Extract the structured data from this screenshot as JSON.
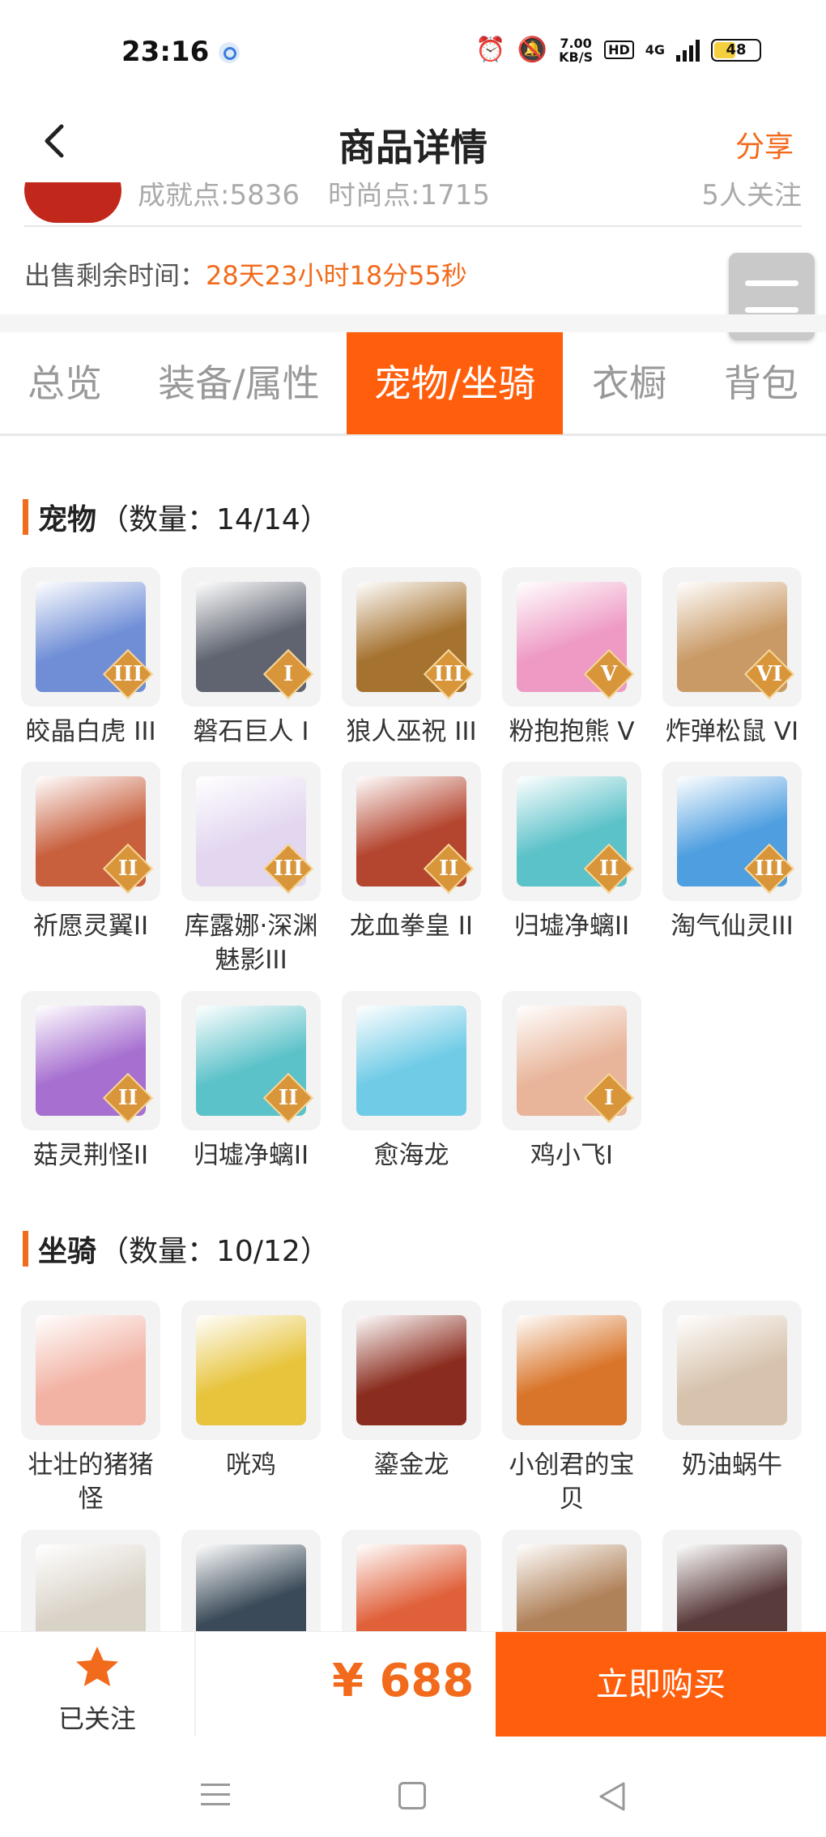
{
  "status_bar": {
    "time": "23:16",
    "speed_value": "7.00",
    "speed_unit": "KB/S",
    "hd": "HD",
    "network": "4G",
    "battery": "48",
    "battery_fraction": 0.48
  },
  "nav": {
    "title": "商品详情",
    "share_label": "分享"
  },
  "peek": {
    "text1": "成就点:5836",
    "text2": "时尚点:1715",
    "text3": "5人关注"
  },
  "timer": {
    "label": "出售剩余时间：",
    "value": "28天23小时18分55秒"
  },
  "tabs": [
    {
      "label": "总览"
    },
    {
      "label": "装备/属性"
    },
    {
      "label": "宠物/坐骑"
    },
    {
      "label": "衣橱"
    },
    {
      "label": "背包"
    }
  ],
  "active_tab": "宠物/坐骑",
  "pets": {
    "title": "宠物",
    "count": "（数量：14/14）",
    "items": [
      {
        "name": "皎晶白虎 III",
        "rank": "III",
        "color": "#6f8ed6"
      },
      {
        "name": "磐石巨人 I",
        "rank": "I",
        "color": "#5f6470"
      },
      {
        "name": "狼人巫祝 III",
        "rank": "III",
        "color": "#a5722f"
      },
      {
        "name": "粉抱抱熊 V",
        "rank": "V",
        "color": "#ee9ac4"
      },
      {
        "name": "炸弹松鼠 VI",
        "rank": "VI",
        "color": "#c99a66"
      },
      {
        "name": "祈愿灵翼II",
        "rank": "II",
        "color": "#c8603e"
      },
      {
        "name": "库露娜·深渊魅影III",
        "rank": "III",
        "color": "#e3d7f0"
      },
      {
        "name": "龙血拳皇 II",
        "rank": "II",
        "color": "#b4452f"
      },
      {
        "name": "归墟净螭II",
        "rank": "II",
        "color": "#5cc2c9"
      },
      {
        "name": "淘气仙灵III",
        "rank": "III",
        "color": "#4f9fe0"
      },
      {
        "name": "菇灵荆怪II",
        "rank": "II",
        "color": "#a66fd0"
      },
      {
        "name": "归墟净螭II",
        "rank": "II",
        "color": "#5cc2c9"
      },
      {
        "name": "愈海龙",
        "rank": "",
        "color": "#6fcbe6"
      },
      {
        "name": "鸡小飞I",
        "rank": "I",
        "color": "#e8b59a"
      }
    ]
  },
  "mounts": {
    "title": "坐骑",
    "count": "（数量：10/12）",
    "items": [
      {
        "name": "壮壮的猪猪怪",
        "color": "#f2b3a4"
      },
      {
        "name": "咣鸡",
        "color": "#e7c43c"
      },
      {
        "name": "鎏金龙",
        "color": "#8a2c1e"
      },
      {
        "name": "小创君的宝贝",
        "color": "#d9752a"
      },
      {
        "name": "奶油蜗牛",
        "color": "#d7c3ad"
      },
      {
        "name": "",
        "color": "#d9d2c7"
      },
      {
        "name": "",
        "color": "#3a4a58"
      },
      {
        "name": "",
        "color": "#e0603a"
      },
      {
        "name": "",
        "color": "#b0825a"
      },
      {
        "name": "",
        "color": "#5a3b3b"
      }
    ]
  },
  "bottom": {
    "follow_label": "已关注",
    "price": "¥ 688",
    "buy_label": "立即购买"
  }
}
